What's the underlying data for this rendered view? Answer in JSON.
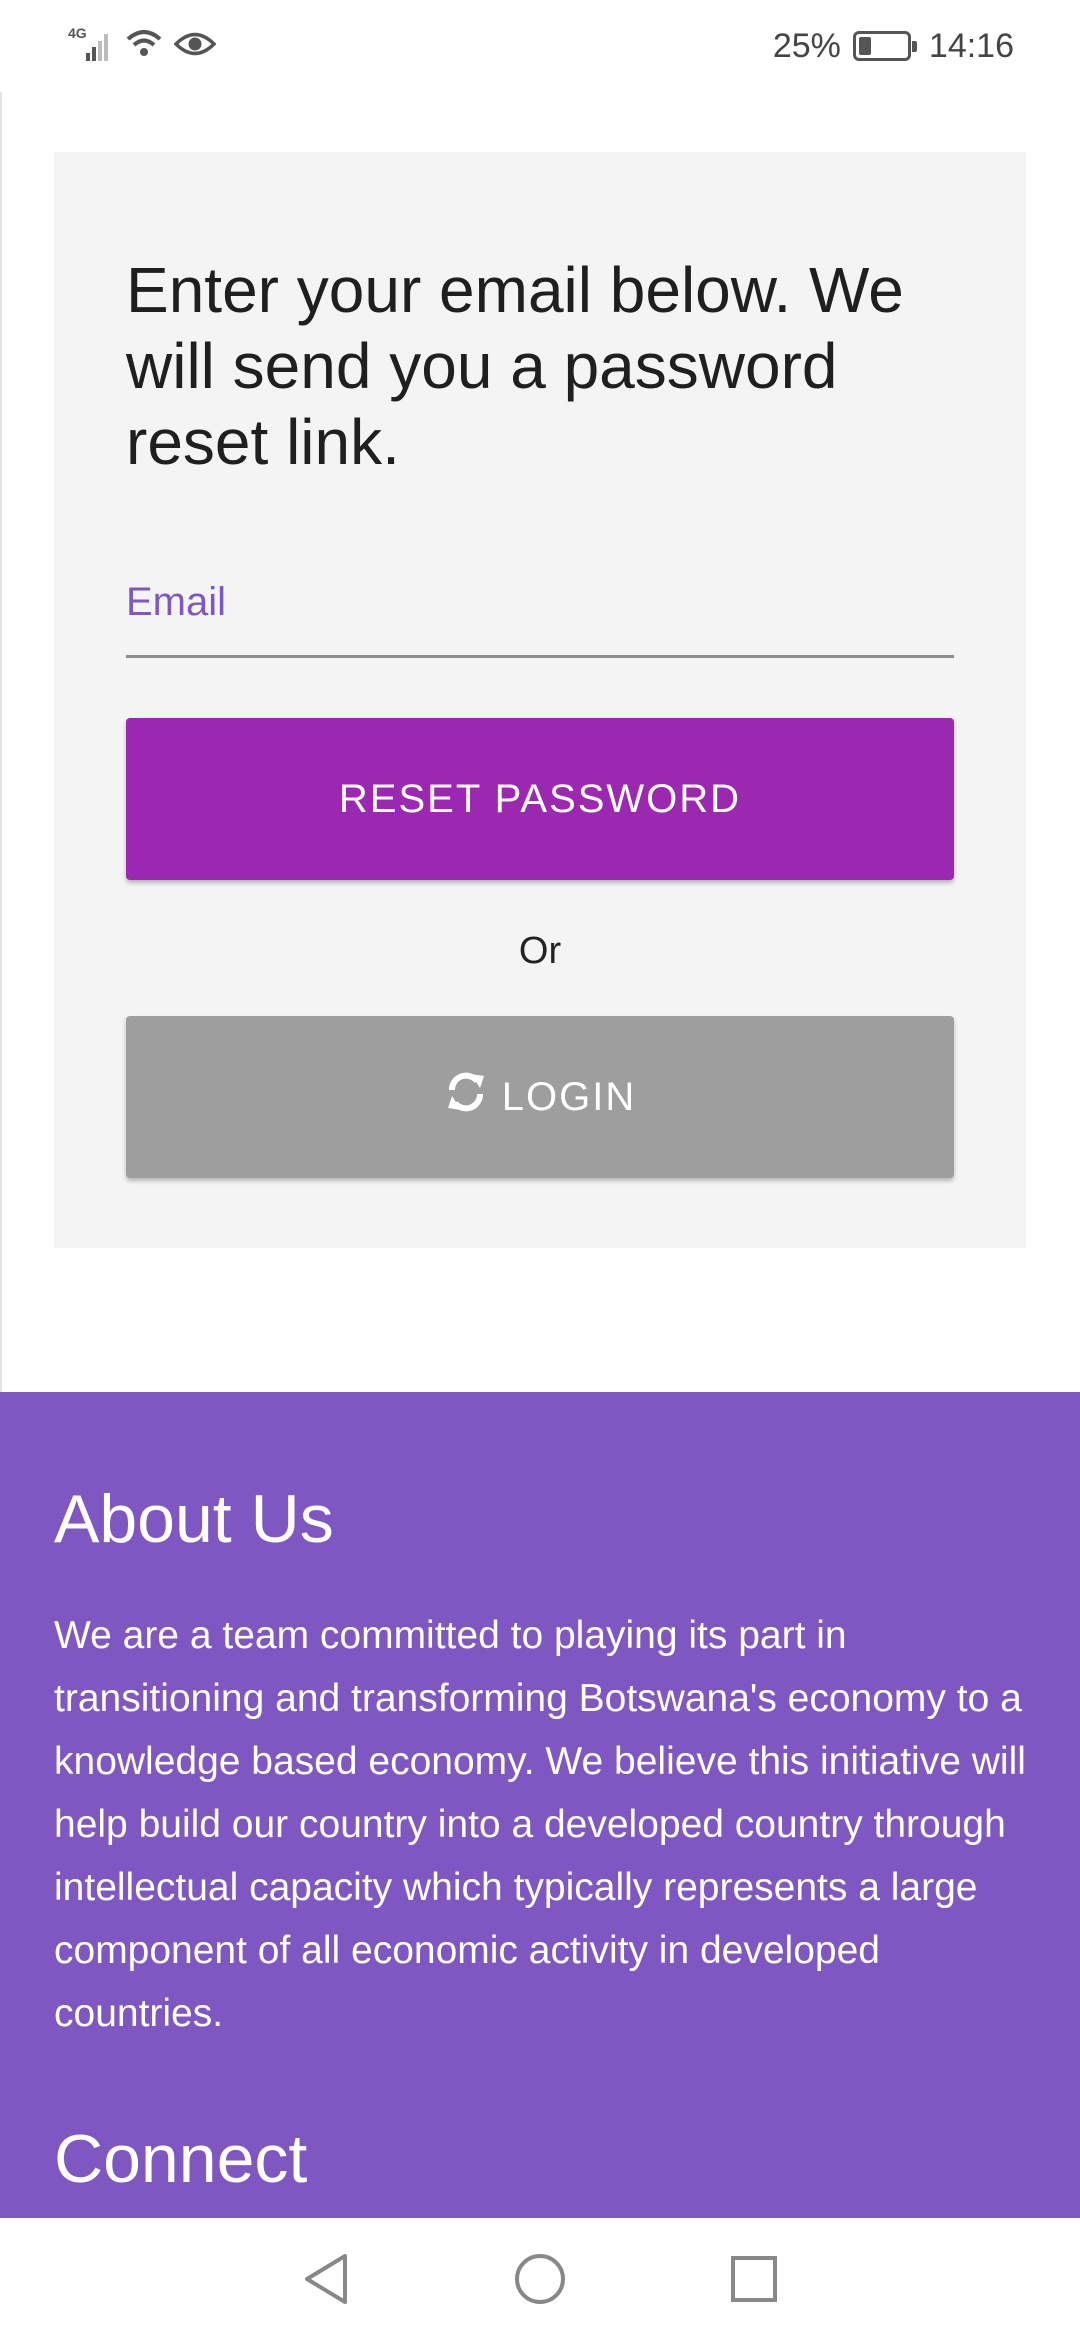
{
  "status_bar": {
    "network": "4G",
    "battery_percent": "25%",
    "battery_level": 0.25,
    "time": "14:16",
    "icons": [
      "signal-icon",
      "wifi-icon",
      "eye-icon",
      "battery-icon"
    ]
  },
  "reset_card": {
    "heading": "Enter your email below. We will send you a password reset link.",
    "email_label": "Email",
    "email_value": "",
    "reset_button": "RESET PASSWORD",
    "or_text": "Or",
    "login_button": "LOGIN",
    "login_icon": "refresh-icon"
  },
  "about": {
    "title": "About Us",
    "text": "We are a team committed to playing its part in transitioning and transforming Botswana's economy to a knowledge based economy. We believe this initiative will help build our country into a developed country through intellectual capacity which typically represents a large component of all economic activity in developed countries.",
    "connect_title": "Connect"
  },
  "nav_bar": {
    "icons": [
      "back-icon",
      "home-icon",
      "recents-icon"
    ]
  },
  "colors": {
    "primary_purple": "#9c27b0",
    "about_bg": "#7e57c2",
    "login_grey": "#9e9e9e",
    "card_bg": "#f4f4f4"
  }
}
